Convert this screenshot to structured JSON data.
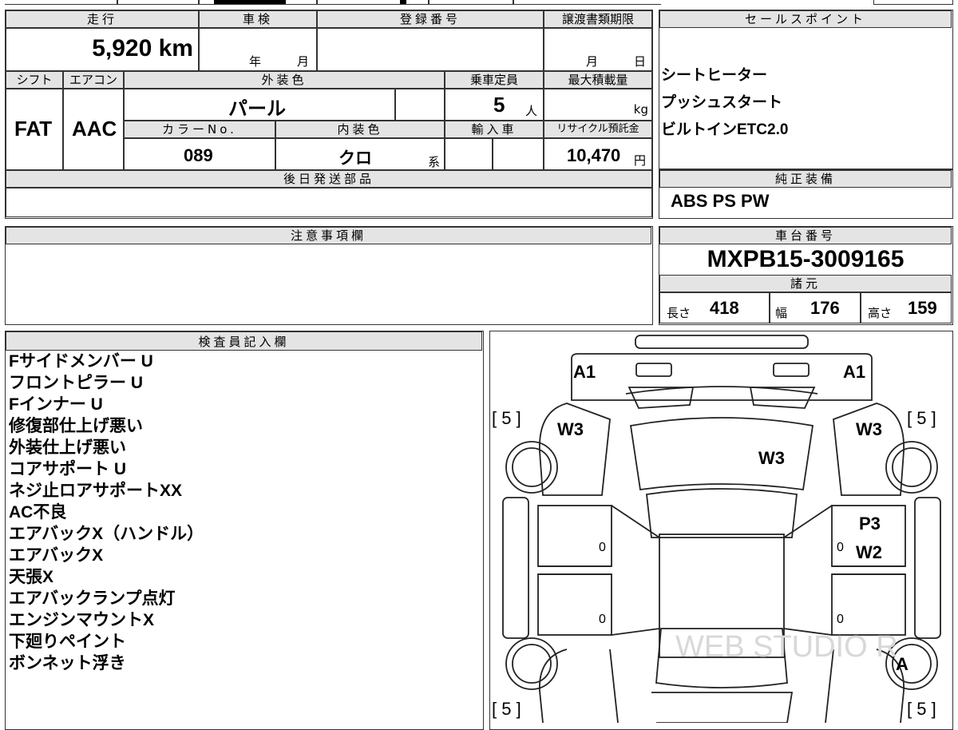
{
  "vehicle": {
    "mileage": {
      "label": "走行",
      "value": "5,920 km"
    },
    "inspection": {
      "label": "車検",
      "year_label": "年",
      "month_label": "月"
    },
    "registration": {
      "label": "登録番号"
    },
    "transfer_deadline": {
      "label": "譲渡書類期限",
      "month_label": "月",
      "day_label": "日"
    },
    "shift": {
      "label": "シフト",
      "value": "FAT"
    },
    "aircon": {
      "label": "エアコン",
      "value": "AAC"
    },
    "exterior_color": {
      "label": "外装色",
      "value": "パール"
    },
    "capacity": {
      "label": "乗車定員",
      "value": "5",
      "unit": "人"
    },
    "max_load": {
      "label": "最大積載量",
      "unit": "kg"
    },
    "color_no": {
      "label": "カラーNo.",
      "value": "089"
    },
    "interior_color": {
      "label": "内装色",
      "value": "クロ",
      "suffix": "系"
    },
    "import": {
      "label": "輸入車"
    },
    "recycle_fee": {
      "label": "リサイクル預託金",
      "value": "10,470",
      "unit": "円"
    },
    "later_parts": {
      "label": "後日発送部品"
    }
  },
  "sales_points": {
    "label": "セールスポイント",
    "items": [
      "シートヒーター",
      "プッシュスタート",
      "ビルトインETC2.0"
    ]
  },
  "genuine_equipment": {
    "label": "純正装備",
    "value": "ABS PS PW"
  },
  "notes": {
    "label": "注意事項欄"
  },
  "chassis": {
    "label": "車台番号",
    "value": "MXPB15-3009165"
  },
  "specs": {
    "label": "諸元",
    "length_label": "長さ",
    "length": "418",
    "width_label": "幅",
    "width": "176",
    "height_label": "高さ",
    "height": "159"
  },
  "inspector": {
    "label": "検査員記入欄",
    "lines": [
      "Fサイドメンバー U",
      "フロントピラー U",
      "Fインナー U",
      "修復部仕上げ悪い",
      "外装仕上げ悪い",
      "コアサポート U",
      "ネジ止ロアサポートXX",
      "AC不良",
      "エアバックX（ハンドル）",
      "エアバックX",
      "天張X",
      "エアバックランプ点灯",
      "エンジンマウントX",
      "下廻りペイント",
      "ボンネット浮き"
    ]
  },
  "diagram": {
    "marks": {
      "a1_left": "A1",
      "a1_right": "A1",
      "w3_left": "W3",
      "w3_right": "W3",
      "w3_center": "W3",
      "p3": "P3",
      "w2": "W2",
      "a": "A",
      "bracket_tl": "[ 5 ]",
      "bracket_tr": "[ 5 ]",
      "bracket_bl": "[ 5 ]",
      "bracket_br": "[ 5 ]",
      "zero_1": "0",
      "zero_2": "0",
      "zero_3": "0",
      "zero_4": "0"
    },
    "watermark": "WEB STUDIO R"
  }
}
